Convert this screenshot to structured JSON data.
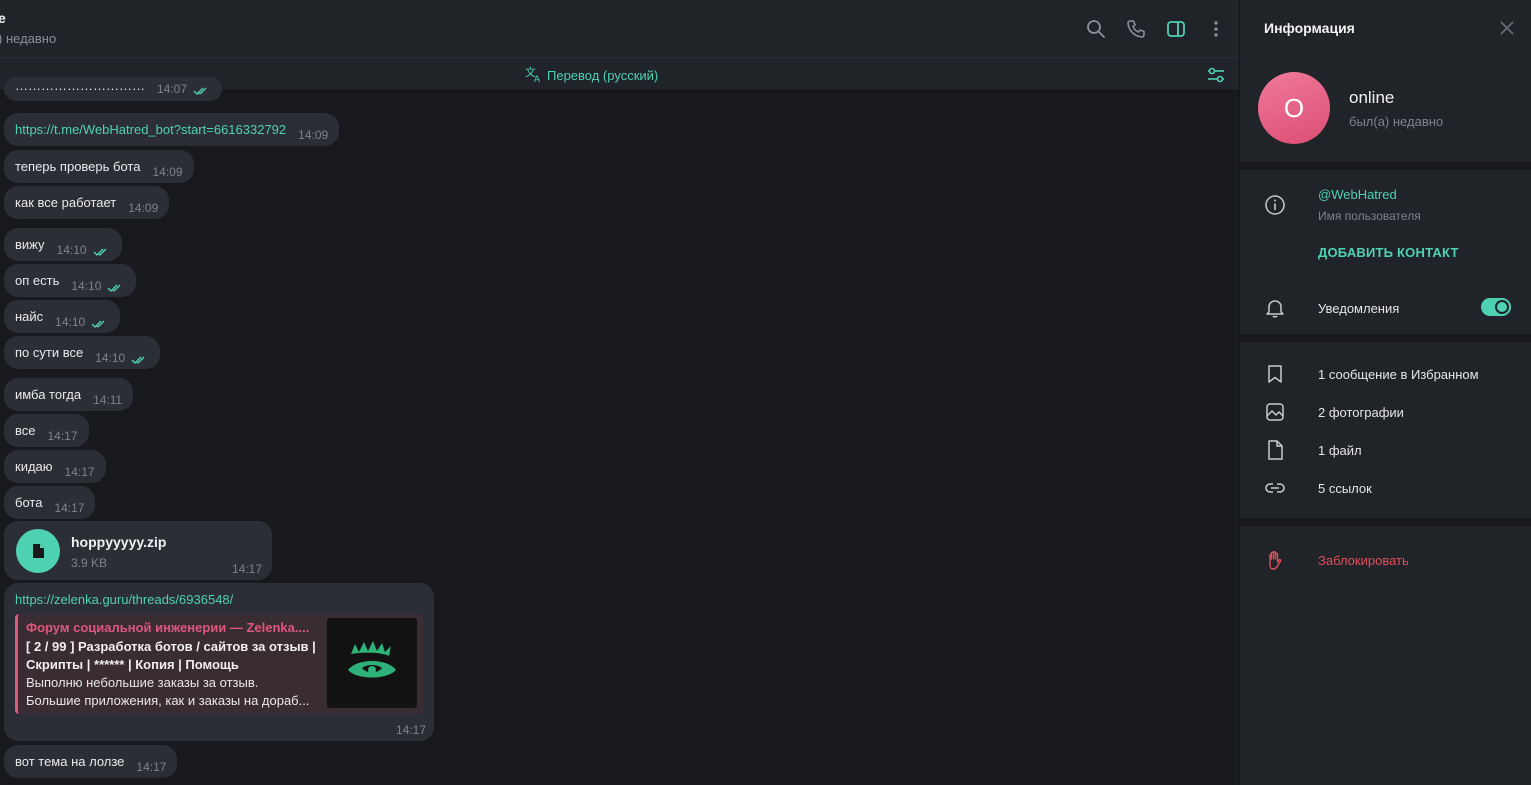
{
  "chat": {
    "header": {
      "title": "e",
      "status": ") недавно"
    },
    "translate_label": "Перевод (русский)",
    "messages": [
      {
        "text": "https://t.me/WebHatred_bot?start=6616332792",
        "time": "14:09"
      },
      {
        "text": "теперь проверь бота",
        "time": "14:09"
      },
      {
        "text": "как все работает",
        "time": "14:09"
      },
      {
        "text": "вижу",
        "time": "14:10"
      },
      {
        "text": "оп есть",
        "time": "14:10"
      },
      {
        "text": "найс",
        "time": "14:10"
      },
      {
        "text": "по сути все",
        "time": "14:10"
      },
      {
        "text": "имба тогда",
        "time": "14:11"
      },
      {
        "text": "все",
        "time": "14:17"
      },
      {
        "text": "кидаю",
        "time": "14:17"
      },
      {
        "text": "бота",
        "time": "14:17"
      },
      {
        "text": "вот тема на лолзе",
        "time": "14:17"
      }
    ],
    "partial_message": {
      "text": "…………………………",
      "time": "14:07"
    },
    "file": {
      "name": "hoppyyyyy.zip",
      "size": "3.9 KB",
      "time": "14:17"
    },
    "preview": {
      "url": "https://zelenka.guru/threads/6936548/",
      "site": "Форум социальной инженерии — Zelenka....",
      "title": "[ 2 / 99 ] Разработка ботов / сайтов за отзыв | Скрипты | ****** | Копия | Помощь",
      "desc_line1": "Выполню небольшие заказы за отзыв.",
      "desc_line2": "Большие приложения, как и заказы на дораб...",
      "time": "14:17"
    }
  },
  "info": {
    "title": "Информация",
    "avatar_letter": "O",
    "name": "online",
    "status": "был(а) недавно",
    "username": "@WebHatred",
    "username_label": "Имя пользователя",
    "add_contact": "ДОБАВИТЬ КОНТАКТ",
    "notifications": "Уведомления",
    "notifications_on": true,
    "media": {
      "saved": "1 сообщение в Избранном",
      "photos": "2 фотографии",
      "files": "1 файл",
      "links": "5 ссылок"
    },
    "block": "Заблокировать"
  },
  "colors": {
    "accent": "#4fd1b3",
    "danger": "#e0505c",
    "bubble": "#2b2e34",
    "panel": "#202328"
  }
}
